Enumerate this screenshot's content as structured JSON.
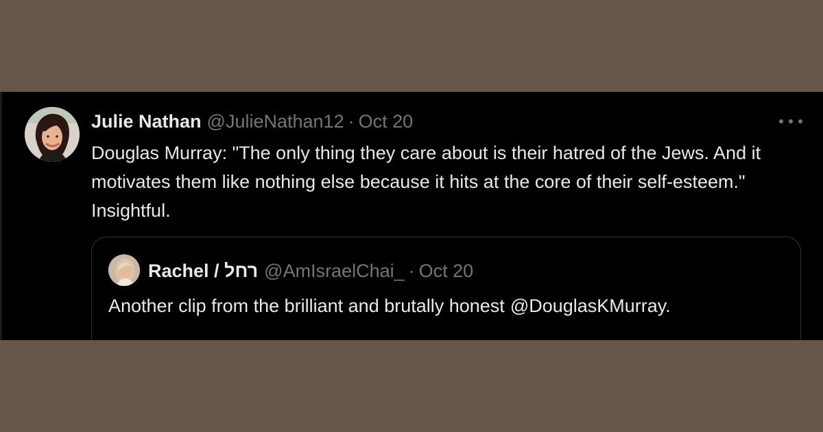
{
  "colors": {
    "page_background": "#65564a",
    "tweet_background": "#000000",
    "primary_text": "#e7e9ea",
    "secondary_text": "#71767b",
    "quote_border": "#2f3336"
  },
  "tweet": {
    "author_name": "Julie Nathan",
    "author_handle": "@JulieNathan12",
    "separator": "·",
    "date": "Oct 20",
    "more_icon": "more-dots-icon",
    "text": "Douglas Murray: \"The only thing they care about is their hatred of the Jews. And it motivates them like nothing else because it hits at the core of their self-esteem.\" Insightful.",
    "quote": {
      "author_name": "Rachel / רחל",
      "author_handle": "@AmIsraelChai_",
      "separator": "·",
      "date": "Oct 20",
      "text": "Another clip from the brilliant and brutally honest",
      "mention": "@DouglasKMurray."
    }
  }
}
